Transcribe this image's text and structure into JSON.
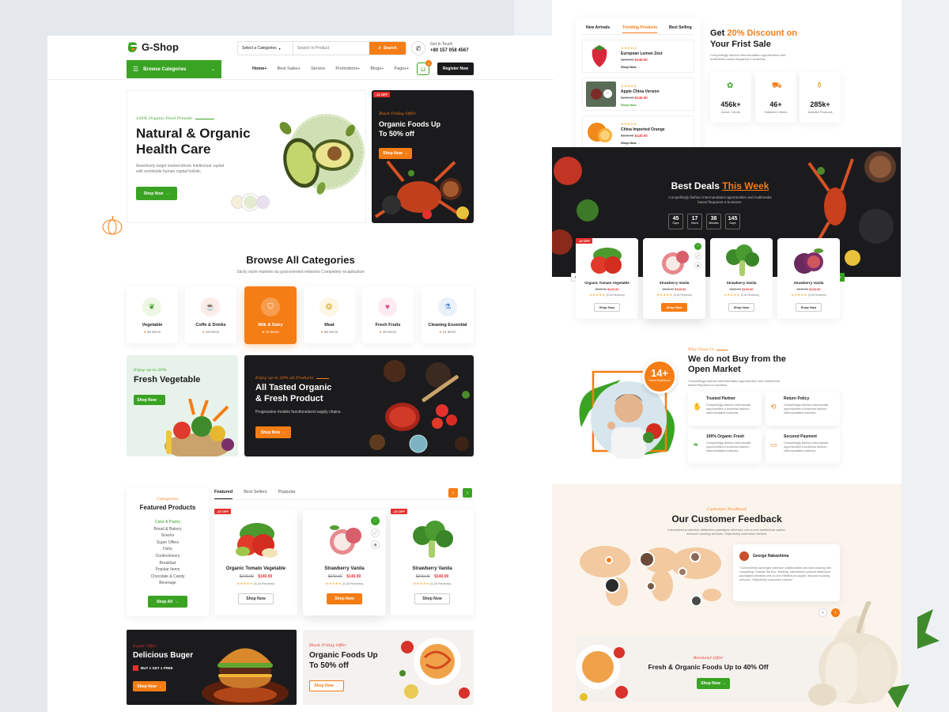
{
  "header": {
    "logo": "G-Shop",
    "category_select": "Select a Categories",
    "search_placeholder": "Search In Product",
    "search_button": "Search",
    "contact_label": "Get In Touch",
    "contact_phone": "+80 157 058 4567",
    "browse": "Browse Categories",
    "nav": [
      "Home+",
      "Best Sales+",
      "Service",
      "Promotions+",
      "Blogs+",
      "Pages+"
    ],
    "cart_count": "0",
    "register": "Register Now"
  },
  "hero": {
    "eyebrow": "100% Organic Feed Provide",
    "title_line1": "Natural & Organic",
    "title_line2": "Health Care",
    "desc_line1": "Assertively target market-driven intellectual capital",
    "desc_line2": "with worldwide human capital holistic.",
    "cta": "Shop Now"
  },
  "promo_side": {
    "tag": "-12 OFF",
    "eyebrow": "Black Friday Offer",
    "title_line1": "Organic Foods Up",
    "title_line2": "To 50% off",
    "cta": "Shop Now"
  },
  "categories": {
    "title": "Browse All Categories",
    "subtitle": "Sticky niche markets via goal-oriented networks Completely recaptiualize",
    "items": [
      {
        "name": "Vegetable",
        "count": "25 Items"
      },
      {
        "name": "Coffe & Drinks",
        "count": "15 Items"
      },
      {
        "name": "Milk & Dairy",
        "count": "18 Items"
      },
      {
        "name": "Meat",
        "count": "55 Items"
      },
      {
        "name": "Fresh Fruits",
        "count": "30 Items"
      },
      {
        "name": "Cleaning Essential",
        "count": "14 Items"
      }
    ]
  },
  "banner_veg": {
    "eyebrow": "Enjoy up to 20%",
    "title": "Fresh Vegetable",
    "cta": "Shop Now"
  },
  "banner_tasted": {
    "eyebrow": "Enjoy up to 20% all Products",
    "title_line1": "All Tasted Organic",
    "title_line2": "& Fresh Product",
    "desc": "Progressive models functionalized supply chains.",
    "cta": "Shop Now"
  },
  "featured": {
    "eyebrow": "Categories",
    "title": "Featured Products",
    "list": [
      "Cake & Pastry",
      "Bread & Bakery",
      "Snacks",
      "Super Offers",
      "Dairy",
      "Confectionery",
      "Breakfast",
      "Popular Items",
      "Chocolate & Candy",
      "Beverage"
    ],
    "shop_all": "Shop All",
    "tabs": [
      "Featured",
      "Best Sellers",
      "Poppular"
    ],
    "products": [
      {
        "tag": "-10 OFF",
        "name": "Organic Tomato Vegetable",
        "old": "$240.00",
        "price": "$140.00",
        "reviews": "(5.2k Reviews)",
        "cta": "Shop Now"
      },
      {
        "tag": "",
        "name": "Strawberry Vanila",
        "old": "$240.00",
        "price": "$140.00",
        "reviews": "(5.2k Reviews)",
        "cta": "Shop Now"
      },
      {
        "tag": "-10 OFF",
        "name": "Strawberry Vanila",
        "old": "$240.00",
        "price": "$140.00",
        "reviews": "(5.2k Reviews)",
        "cta": "Shop Now"
      }
    ]
  },
  "bottom_banners": {
    "burger": {
      "eyebrow": "Super Offer",
      "title": "Delicious Buger",
      "badge": "BUY 1 GET 1 FREE",
      "cta": "Shop Now"
    },
    "organic": {
      "eyebrow": "Black Friday Offer",
      "title_line1": "Organic Foods Up",
      "title_line2": "To 50% off",
      "cta": "Shop Now"
    }
  },
  "trending": {
    "tabs": [
      "New Arrivals",
      "Trending Products",
      "Best Selling"
    ],
    "items": [
      {
        "name": "European Lemon Zest",
        "old": "$240.00",
        "price": "$140.00",
        "cta": "Shop Now"
      },
      {
        "name": "Apple China Version",
        "old": "$240.00",
        "price": "$140.00",
        "cta": "Shop Now"
      },
      {
        "name": "China Imported Orange",
        "old": "$240.00",
        "price": "$140.00",
        "cta": "Shop Now"
      }
    ]
  },
  "discount": {
    "title_pre": "Get ",
    "title_accent": "20% Discount on",
    "title_line2": "Your Frist Sale",
    "desc_line1": "Compellingly fashion intermandated opportunities and",
    "desc_line2": "multimedia based fitoparent e-business.",
    "stats": [
      {
        "value": "456k+",
        "label": "Active Clients"
      },
      {
        "value": "46+",
        "label": "Satisfied Clients"
      },
      {
        "value": "285k+",
        "label": "Activate Products"
      }
    ]
  },
  "deals": {
    "title_pre": "Best Deals ",
    "title_accent": "This Week",
    "desc_line1": "Compellingly fashion intermandated opportunities and multimedia",
    "desc_line2": "based fitoparent e-business.",
    "timer": [
      {
        "value": "45",
        "unit": "Days"
      },
      {
        "value": "17",
        "unit": "Hours"
      },
      {
        "value": "38",
        "unit": "Minutes"
      },
      {
        "value": "145",
        "unit": "Days"
      }
    ],
    "products": [
      {
        "tag": "-10 OFF",
        "name": "Organic Tomato Vegetable",
        "old": "$240.00",
        "price": "$140.00",
        "reviews": "(5.2k Reviews)",
        "cta": "Shop Now"
      },
      {
        "tag": "",
        "name": "Strawberry Vanila",
        "old": "$240.00",
        "price": "$140.00",
        "reviews": "(5.2k Reviews)",
        "cta": "Shop Now"
      },
      {
        "tag": "",
        "name": "Strawberry Vanila",
        "old": "$240.00",
        "price": "$140.00",
        "reviews": "(5.2k Reviews)",
        "cta": "Shop Now"
      },
      {
        "tag": "",
        "name": "Strawberry Vanila",
        "old": "$240.00",
        "price": "$140.00",
        "reviews": "(5.2k Reviews)",
        "cta": "Shop Now"
      }
    ]
  },
  "whyus": {
    "eyebrow": "Why Chose Us",
    "title_line1": "We do not Buy from the",
    "title_line2": "Open Market",
    "desc_line1": "Compellingly fashion intermandated opportunities and multimedia",
    "desc_line2": "based fitoparent e-business.",
    "badge_value": "14+",
    "badge_label": "Year's Experience",
    "features": [
      {
        "title": "Trusted Partner",
        "desc": "Compellingly fashion intermandat opportunities e-business fashion intermandated business."
      },
      {
        "title": "Return Policy",
        "desc": "Compellingly fashion intermandat opportunities e-business fashion intermandated business."
      },
      {
        "title": "100% Organic Fresh",
        "desc": "Compellingly fashion intermandat opportunities e-business fashion intermandated business."
      },
      {
        "title": "Secured Payment",
        "desc": "Compellingly fashion intermandat opportunities e-business fashion intermandated business."
      }
    ]
  },
  "feedback": {
    "eyebrow": "Customer Feedback",
    "title": "Our Customer Feedback",
    "desc_line1": "Interactived productive distinctive paradigms whereas one-to-one intellectual capital.",
    "desc_line2": "resource sucking services. Objectively customize vertical.",
    "reviewer": "George Nakashima",
    "quote": "\"Conveniently synergize premium collaboration and idea-sharing with compelling \"outside the box\" thinking. Interactived product distinctive paradigms whereas one-to-one intellectual capital. resource sucking services. Objectively customize vertical.\""
  },
  "weekend": {
    "eyebrow": "Weekend Offer",
    "title": "Fresh & Organic Foods Up to 40% Off",
    "cta": "Shop Now"
  },
  "colors": {
    "green": "#3aa323",
    "orange": "#f57d15",
    "red": "#e4312d",
    "dark": "#1b1b1d"
  }
}
